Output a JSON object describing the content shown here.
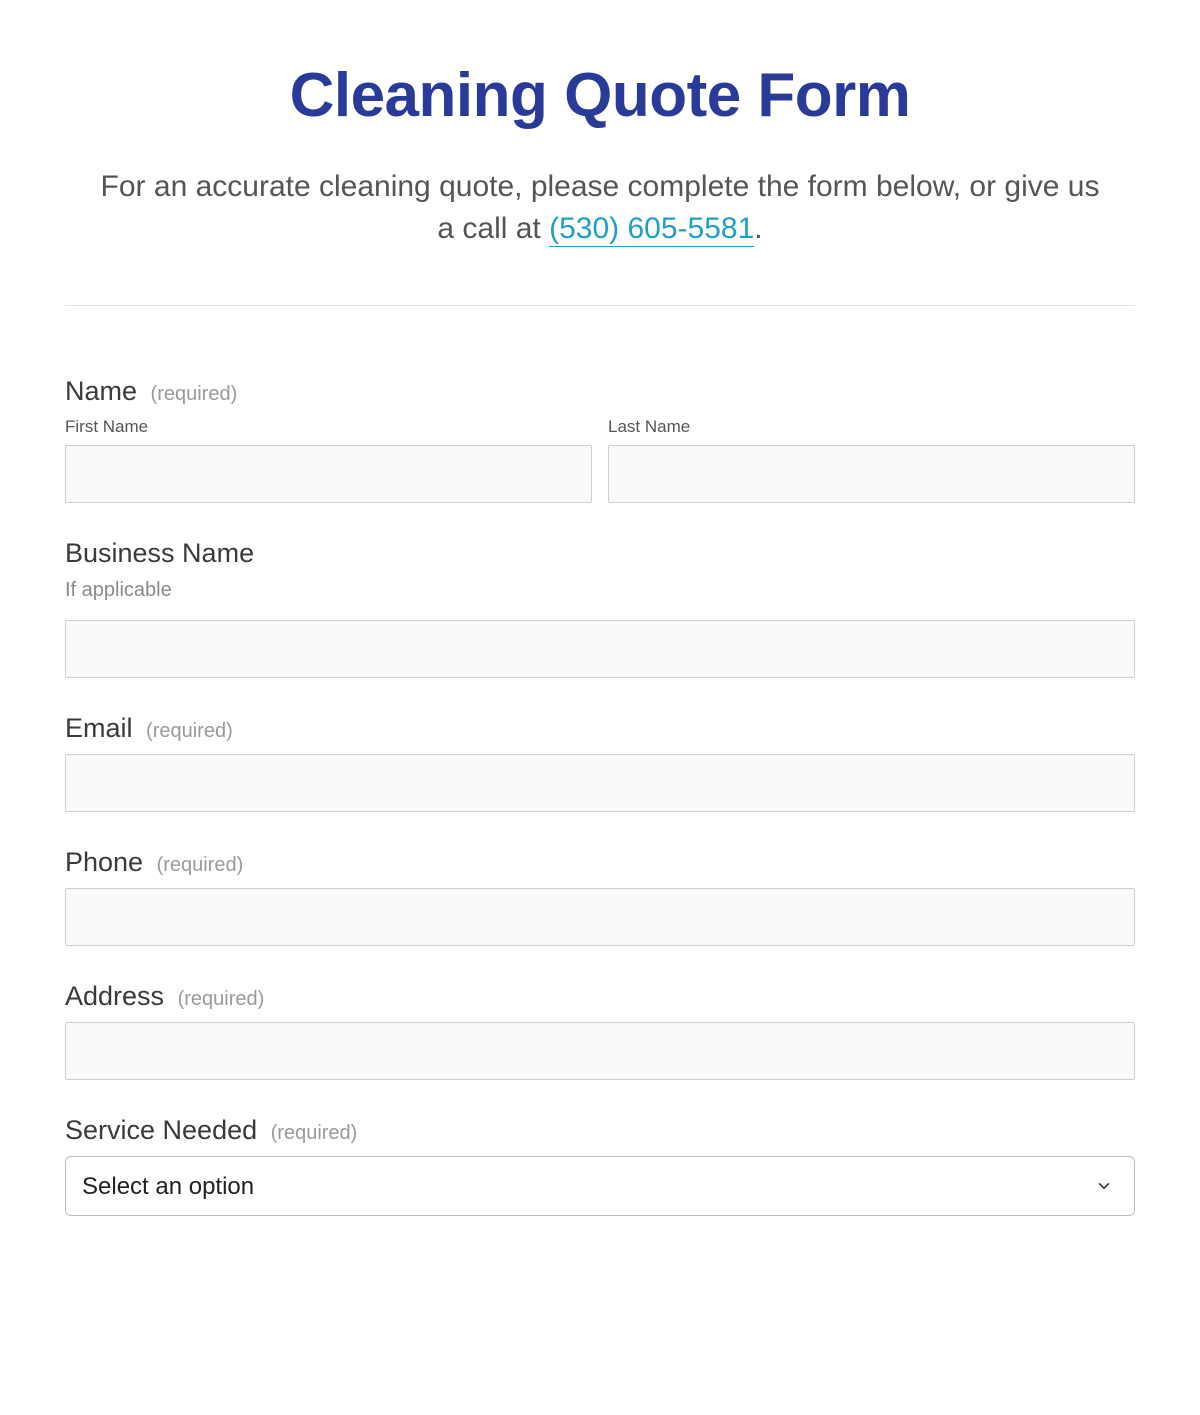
{
  "title": "Cleaning Quote Form",
  "intro": {
    "prefix": "For an accurate cleaning quote, please complete the form below, or give us a call at ",
    "phone": "(530) 605-5581",
    "suffix": "."
  },
  "required_tag": "(required)",
  "fields": {
    "name": {
      "label": "Name",
      "first": "First Name",
      "last": "Last Name"
    },
    "business": {
      "label": "Business Name",
      "hint": "If applicable"
    },
    "email": {
      "label": "Email"
    },
    "phone_field": {
      "label": "Phone"
    },
    "address": {
      "label": "Address"
    },
    "service": {
      "label": "Service Needed",
      "placeholder": "Select an option"
    }
  }
}
